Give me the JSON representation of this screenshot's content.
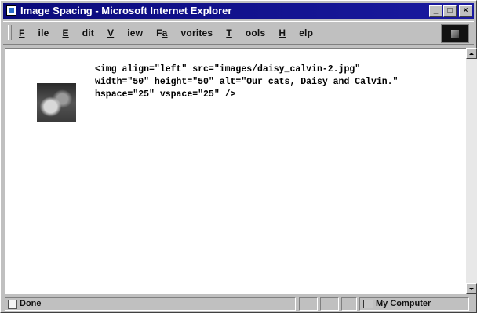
{
  "window": {
    "title": "Image Spacing - Microsoft Internet Explorer"
  },
  "title_buttons": {
    "minimize": "_",
    "maximize": "□",
    "close": "×"
  },
  "menu": [
    {
      "label": "File",
      "key": "F"
    },
    {
      "label": "Edit",
      "key": "E"
    },
    {
      "label": "View",
      "key": "V"
    },
    {
      "label": "Favorites",
      "key": "a"
    },
    {
      "label": "Tools",
      "key": "T"
    },
    {
      "label": "Help",
      "key": "H"
    }
  ],
  "page": {
    "image_alt": "Our cats, Daisy and Calvin.",
    "code": "<img align=\"left\" src=\"images/daisy_calvin-2.jpg\"\nwidth=\"50\" height=\"50\" alt=\"Our cats, Daisy and Calvin.\"\nhspace=\"25\" vspace=\"25\" />"
  },
  "status": {
    "text": "Done",
    "zone": "My Computer"
  }
}
